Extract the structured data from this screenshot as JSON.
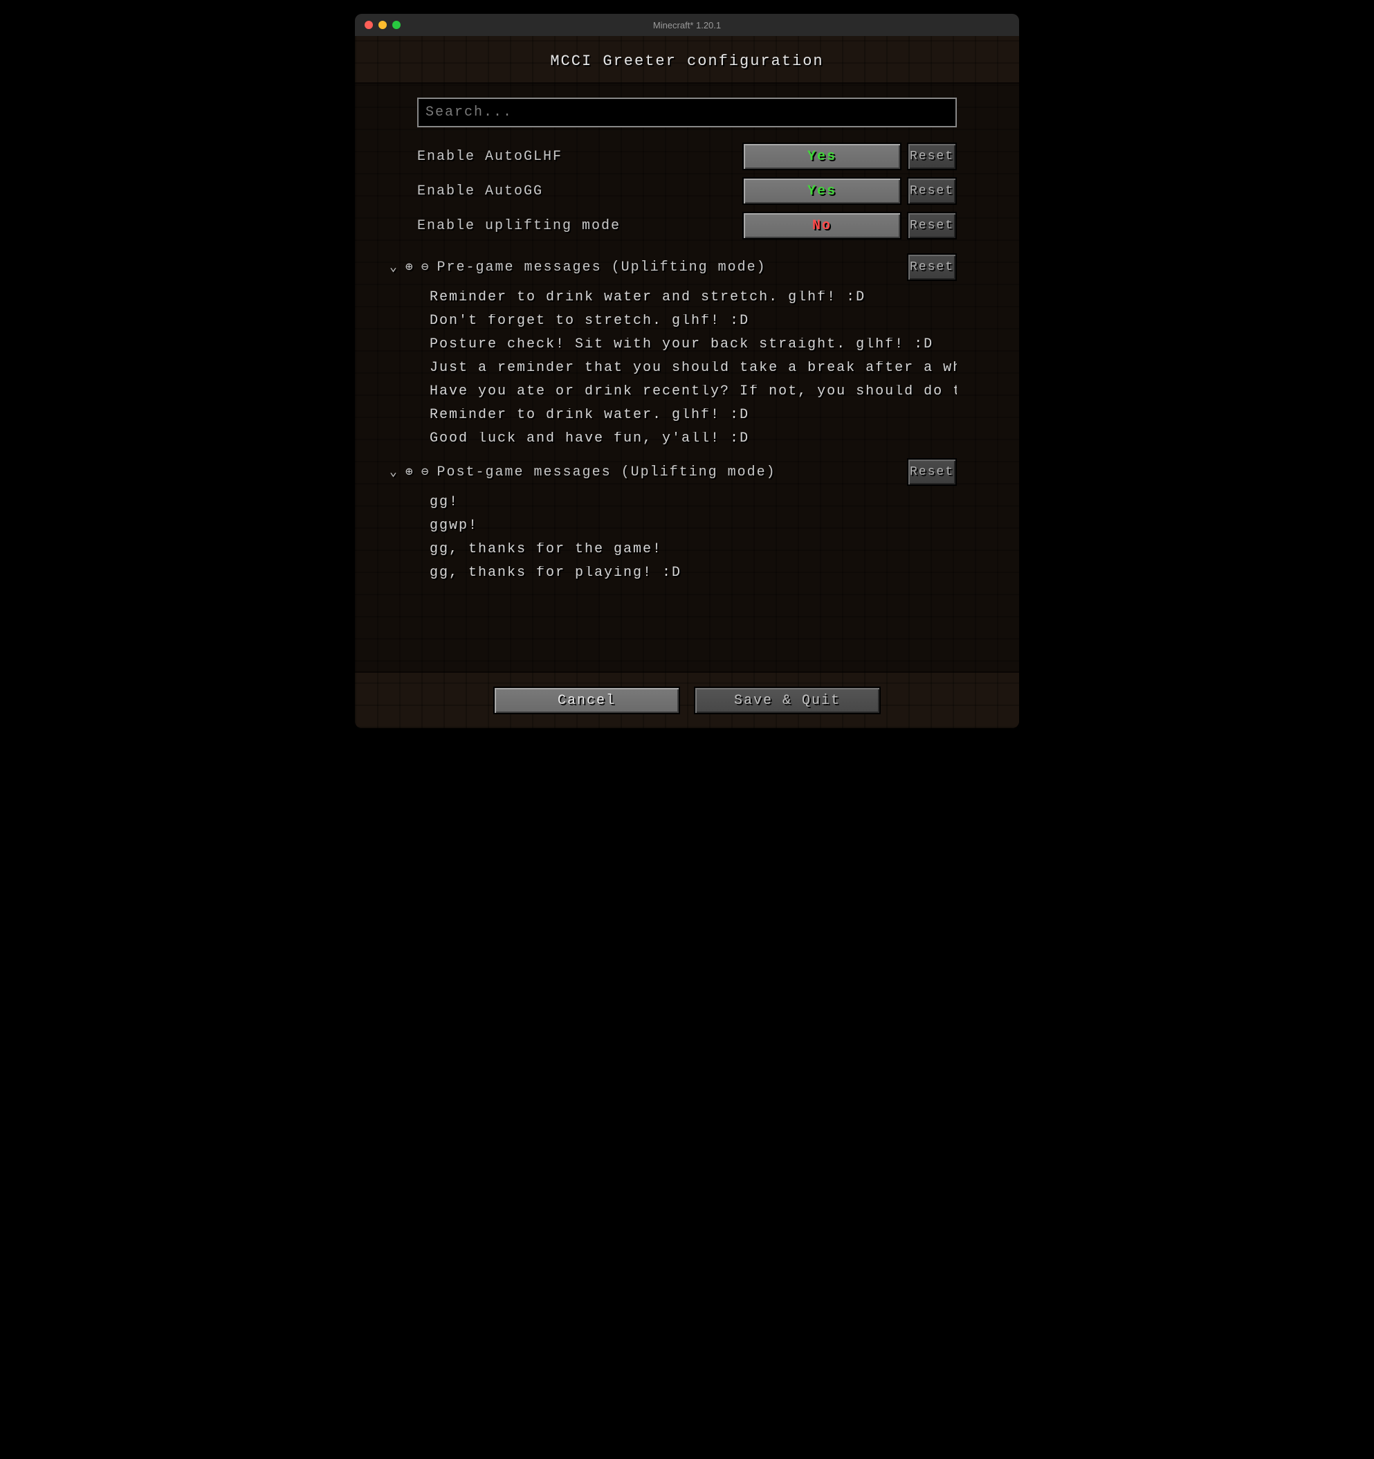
{
  "window": {
    "title": "Minecraft* 1.20.1"
  },
  "page_title": "MCCI Greeter configuration",
  "search": {
    "placeholder": "Search..."
  },
  "labels": {
    "reset": "Reset"
  },
  "options": [
    {
      "label": "Enable AutoGLHF",
      "value": "Yes",
      "value_class": "val-yes"
    },
    {
      "label": "Enable AutoGG",
      "value": "Yes",
      "value_class": "val-yes"
    },
    {
      "label": "Enable uplifting mode",
      "value": "No",
      "value_class": "val-no"
    }
  ],
  "sections": {
    "pre": {
      "title": "Pre-game messages (Uplifting mode)",
      "messages": [
        "Reminder to drink water and stretch. glhf! :D",
        "Don't forget to stretch. glhf! :D",
        "Posture check! Sit with your back straight. glhf! :D",
        "Just a reminder that you should take a break after a while. glhf! :",
        "Have you ate or drink recently? If not, you should do that. glhf! :",
        "Reminder to drink water. glhf! :D",
        "Good luck and have fun, y'all! :D"
      ]
    },
    "post": {
      "title": "Post-game messages (Uplifting mode)",
      "messages": [
        "gg!",
        "ggwp!",
        "gg, thanks for the game!",
        "gg, thanks for playing! :D"
      ]
    }
  },
  "footer": {
    "cancel": "Cancel",
    "save": "Save & Quit"
  }
}
